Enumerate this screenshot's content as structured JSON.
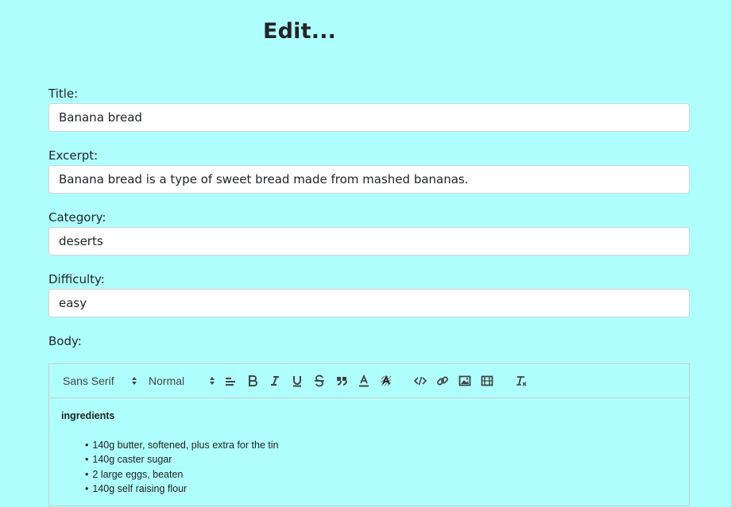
{
  "page": {
    "title": "Edit..."
  },
  "form": {
    "title_label": "Title:",
    "title_value": "Banana bread",
    "excerpt_label": "Excerpt:",
    "excerpt_value": "Banana bread is a type of sweet bread made from mashed bananas.",
    "category_label": "Category:",
    "category_value": "deserts",
    "difficulty_label": "Difficulty:",
    "difficulty_value": "easy",
    "body_label": "Body:"
  },
  "toolbar": {
    "font_value": "Sans Serif",
    "size_value": "Normal",
    "buttons": [
      "align-icon",
      "bold-icon",
      "italic-icon",
      "underline-icon",
      "strike-icon",
      "blockquote-icon",
      "font-color-icon",
      "background-color-icon",
      "code-icon",
      "link-icon",
      "image-icon",
      "video-icon",
      "clear-format-icon"
    ]
  },
  "editor": {
    "heading": "ingredients",
    "items": [
      "140g butter, softened, plus extra for the tin",
      "140g caster sugar",
      "2 large eggs, beaten",
      "140g self raising flour"
    ]
  }
}
